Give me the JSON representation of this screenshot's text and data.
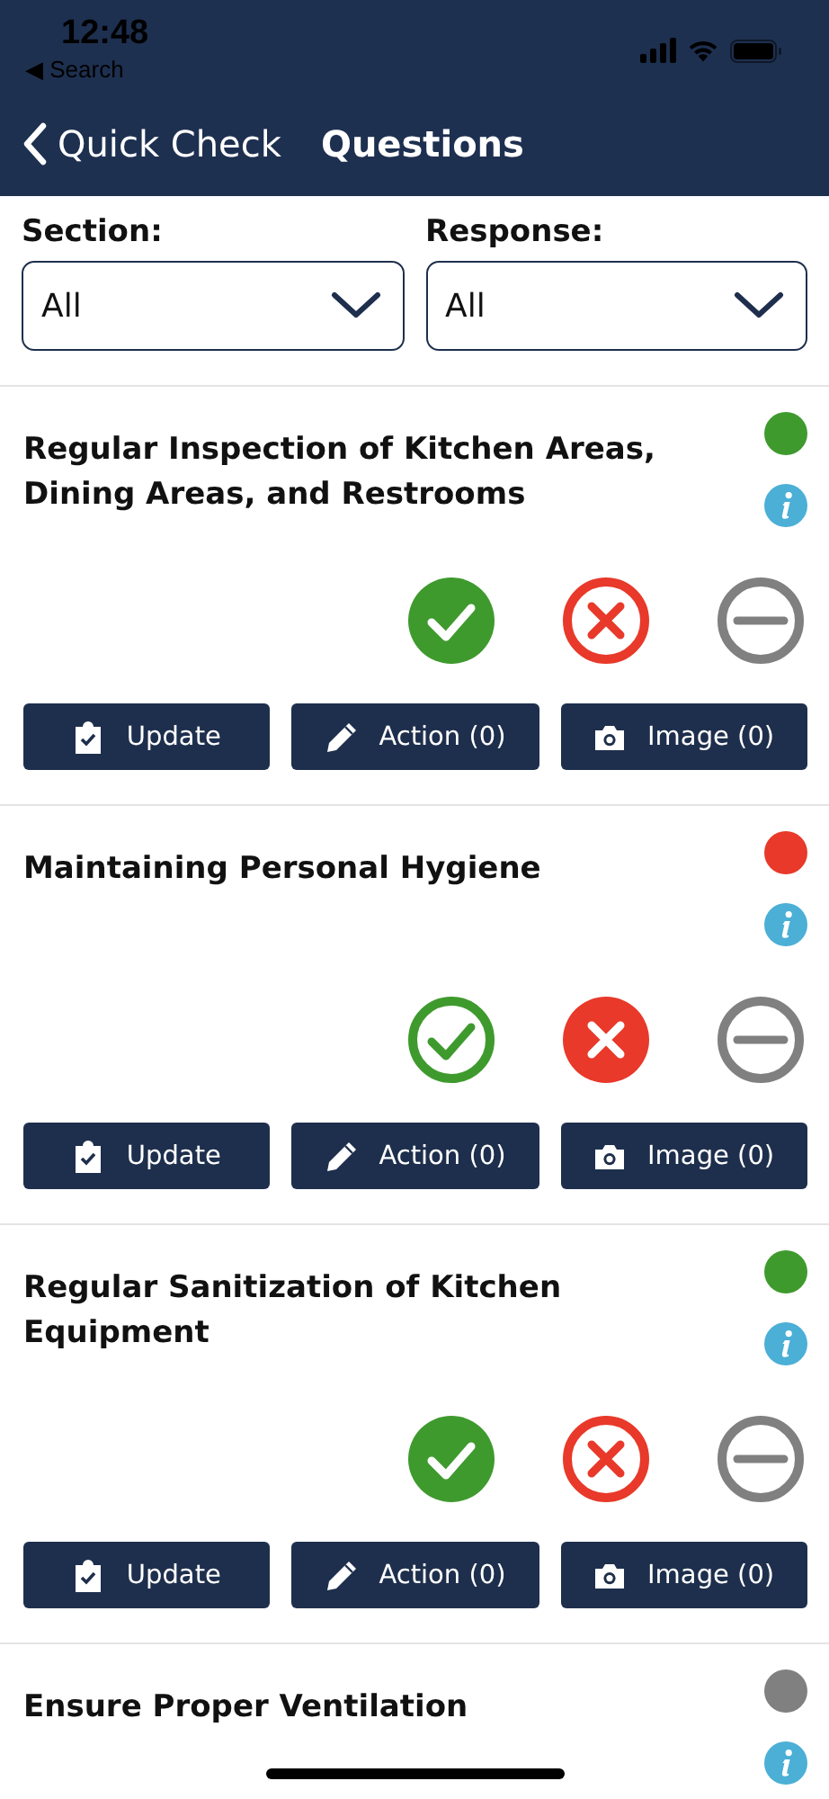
{
  "status_bar": {
    "time": "12:48",
    "back_app": "◀ Search"
  },
  "nav": {
    "back": "Quick Check",
    "title": "Questions"
  },
  "filters": [
    {
      "label": "Section:",
      "value": "All"
    },
    {
      "label": "Response:",
      "value": "All"
    }
  ],
  "items": [
    {
      "title": "Regular Inspection of Kitchen Areas, Dining Areas, and Restrooms",
      "color": "#3f9a2e",
      "responses": [
        {
          "kind": "pass",
          "selected": true
        },
        {
          "kind": "fail",
          "selected": false
        },
        {
          "kind": "na",
          "selected": false
        }
      ],
      "buttons": [
        {
          "kind": "update",
          "label": "Update"
        },
        {
          "kind": "action",
          "label": "Action (0)"
        },
        {
          "kind": "image",
          "label": "Image (0)"
        }
      ]
    },
    {
      "title": "Maintaining Personal Hygiene",
      "color": "#e8392a",
      "responses": [
        {
          "kind": "pass",
          "selected": false
        },
        {
          "kind": "fail",
          "selected": true
        },
        {
          "kind": "na",
          "selected": false
        }
      ],
      "buttons": [
        {
          "kind": "update",
          "label": "Update"
        },
        {
          "kind": "action",
          "label": "Action (0)"
        },
        {
          "kind": "image",
          "label": "Image (0)"
        }
      ]
    },
    {
      "title": "Regular Sanitization of Kitchen Equipment",
      "color": "#3f9a2e",
      "responses": [
        {
          "kind": "pass",
          "selected": true
        },
        {
          "kind": "fail",
          "selected": false
        },
        {
          "kind": "na",
          "selected": false
        }
      ],
      "buttons": [
        {
          "kind": "update",
          "label": "Update"
        },
        {
          "kind": "action",
          "label": "Action (0)"
        },
        {
          "kind": "image",
          "label": "Image (0)"
        }
      ]
    },
    {
      "title": "Ensure Proper Ventilation",
      "color": "#808080"
    }
  ]
}
